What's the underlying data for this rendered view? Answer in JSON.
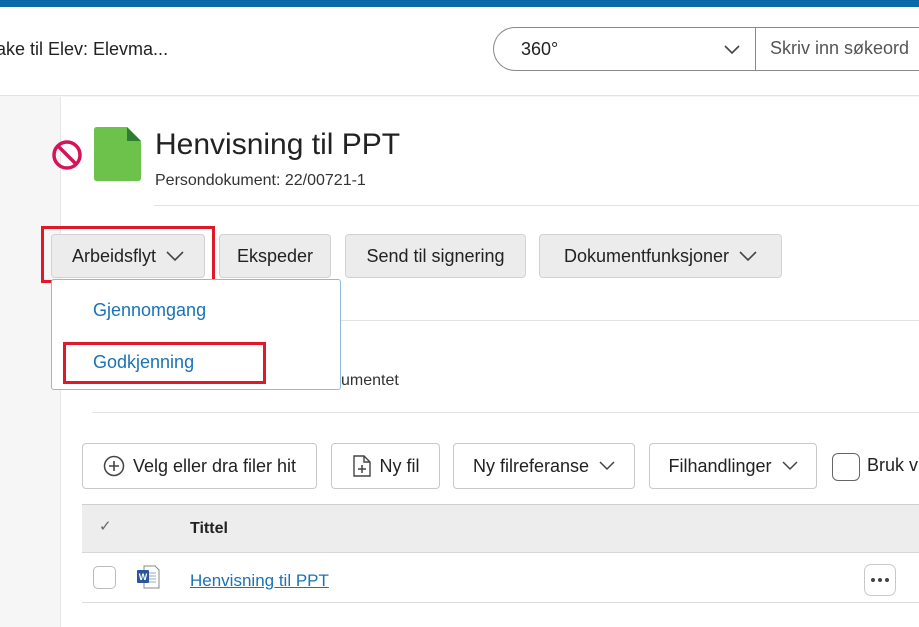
{
  "header": {
    "back_link": "ake til Elev: Elevma...",
    "scope_select": {
      "value": "360°"
    },
    "search": {
      "placeholder": "Skriv inn søkeord"
    }
  },
  "document": {
    "title": "Henvisning til PPT",
    "subtitle": "Persondokument: 22/00721-1"
  },
  "toolbar": {
    "workflow_label": "Arbeidsflyt",
    "dispatch_label": "Ekspeder",
    "signing_label": "Send til signering",
    "doc_functions_label": "Dokumentfunksjoner"
  },
  "workflow_menu": {
    "items": [
      "Gjennomgang",
      "Godkjenning"
    ]
  },
  "partial_text": "umentet",
  "files_toolbar": {
    "select_files": "Velg eller dra filer hit",
    "new_file": "Ny fil",
    "new_file_ref": "Ny filreferanse",
    "file_actions": "Filhandlinger",
    "use_label": "Bruk v"
  },
  "files_table": {
    "header_check": "✓",
    "header_title": "Tittel",
    "rows": [
      {
        "title": "Henvisning til PPT",
        "icon": "word-doc-icon"
      }
    ]
  },
  "colors": {
    "accent": "#0b6aa9",
    "link": "#1a73b5",
    "highlight": "#e0182a",
    "doc_green": "#6cc24a",
    "block_red": "#d4145a"
  }
}
